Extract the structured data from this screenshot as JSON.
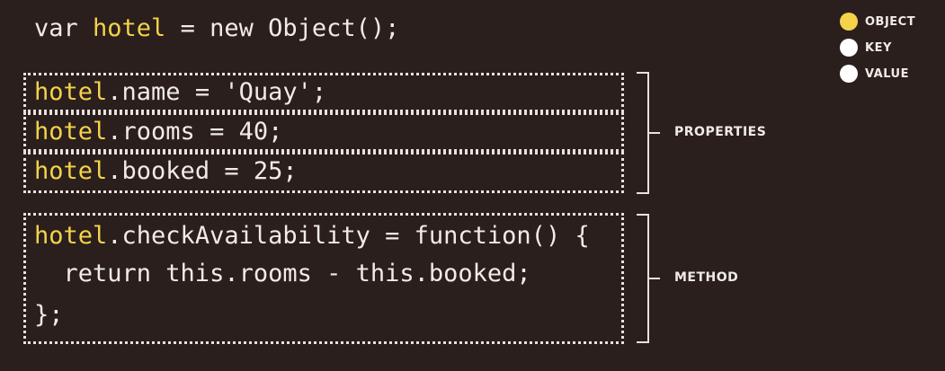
{
  "code": {
    "declaration": {
      "keyword": "var ",
      "object": "hotel",
      "rest": " = new Object();"
    },
    "properties": [
      {
        "object": "hotel",
        "rest": ".name = 'Quay';"
      },
      {
        "object": "hotel",
        "rest": ".rooms = 40;"
      },
      {
        "object": "hotel",
        "rest": ".booked = 25;"
      }
    ],
    "method": {
      "line1": {
        "object": "hotel",
        "rest": ".checkAvailability = function() {"
      },
      "line2": "  return this.rooms - this.booked;",
      "line3": "};"
    }
  },
  "labels": {
    "properties": "PROPERTIES",
    "method": "METHOD"
  },
  "legend": {
    "items": [
      {
        "label": "OBJECT",
        "color": "#f4d34a"
      },
      {
        "label": "KEY",
        "color": "#ffffff"
      },
      {
        "label": "VALUE",
        "color": "#ffffff"
      }
    ]
  },
  "colors": {
    "background": "#2b1f1d",
    "object": "#f4d34a",
    "text": "#f1ebe6"
  }
}
